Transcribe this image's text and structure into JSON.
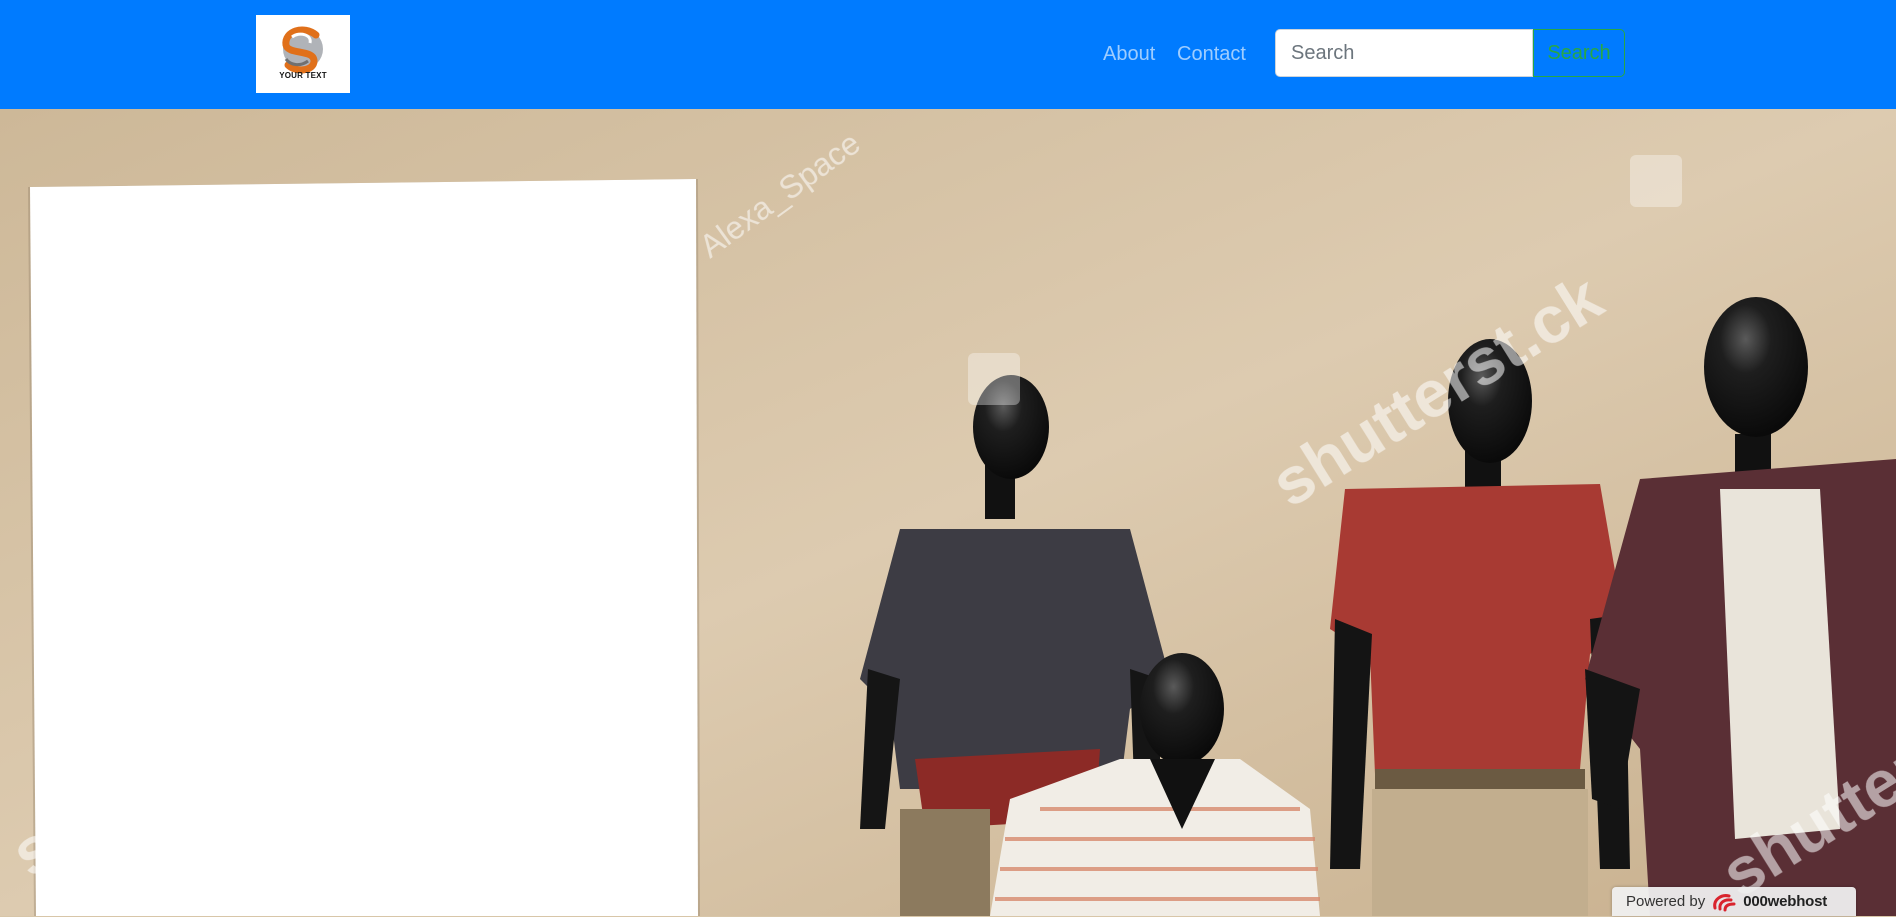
{
  "navbar": {
    "brand": {
      "logo_text": "YOUR TEXT",
      "icon": "s-swirl-logo-icon"
    },
    "links": [
      {
        "label": "About"
      },
      {
        "label": "Contact"
      }
    ],
    "search": {
      "placeholder": "Search",
      "value": "",
      "button_label": "Search"
    },
    "colors": {
      "background": "#007bff",
      "link": "rgba(255,255,255,0.5)",
      "search_button": "#28a745"
    }
  },
  "hero": {
    "image": "storefront-mannequins-with-blank-poster",
    "watermarks": [
      "shutterstock",
      "Alexa_Space"
    ]
  },
  "footer_badge": {
    "powered_label": "Powered by",
    "brand": "000webhost",
    "icon": "000webhost-swirl-icon"
  }
}
